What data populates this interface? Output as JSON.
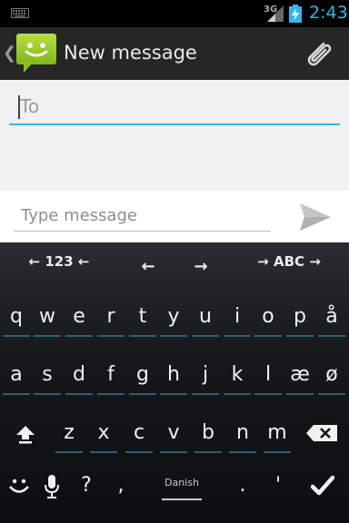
{
  "status_bar": {
    "network": "3G",
    "time": "2:43",
    "accent_color": "#33b5e5"
  },
  "action_bar": {
    "title": "New message",
    "app_icon": "messaging-app-icon",
    "attach_icon": "paperclip-icon"
  },
  "compose": {
    "to_placeholder": "To",
    "message_placeholder": "Type message",
    "send_icon": "send-icon"
  },
  "keyboard": {
    "top_row": [
      "← 123 ←",
      "←",
      "→",
      "→ ABC →"
    ],
    "row1": [
      "q",
      "w",
      "e",
      "r",
      "t",
      "y",
      "u",
      "i",
      "o",
      "p",
      "å"
    ],
    "row2": [
      "a",
      "s",
      "d",
      "f",
      "g",
      "h",
      "j",
      "k",
      "l",
      "æ",
      "ø"
    ],
    "row3": [
      "z",
      "x",
      "c",
      "v",
      "b",
      "n",
      "m"
    ],
    "row4": [
      "?",
      ",",
      ".",
      "'"
    ],
    "language": "Danish"
  }
}
